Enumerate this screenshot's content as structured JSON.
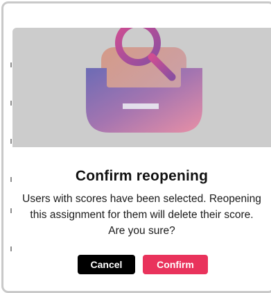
{
  "dialog": {
    "title": "Confirm reopening",
    "message": "Users with scores have been selected. Reopening this assignment for them will delete their score. Are you sure?",
    "cancel_label": "Cancel",
    "confirm_label": "Confirm",
    "illustration": "inbox-search-icon"
  },
  "colors": {
    "overlay": "#cccccc",
    "confirm": "#e9335c",
    "cancel": "#000000"
  }
}
